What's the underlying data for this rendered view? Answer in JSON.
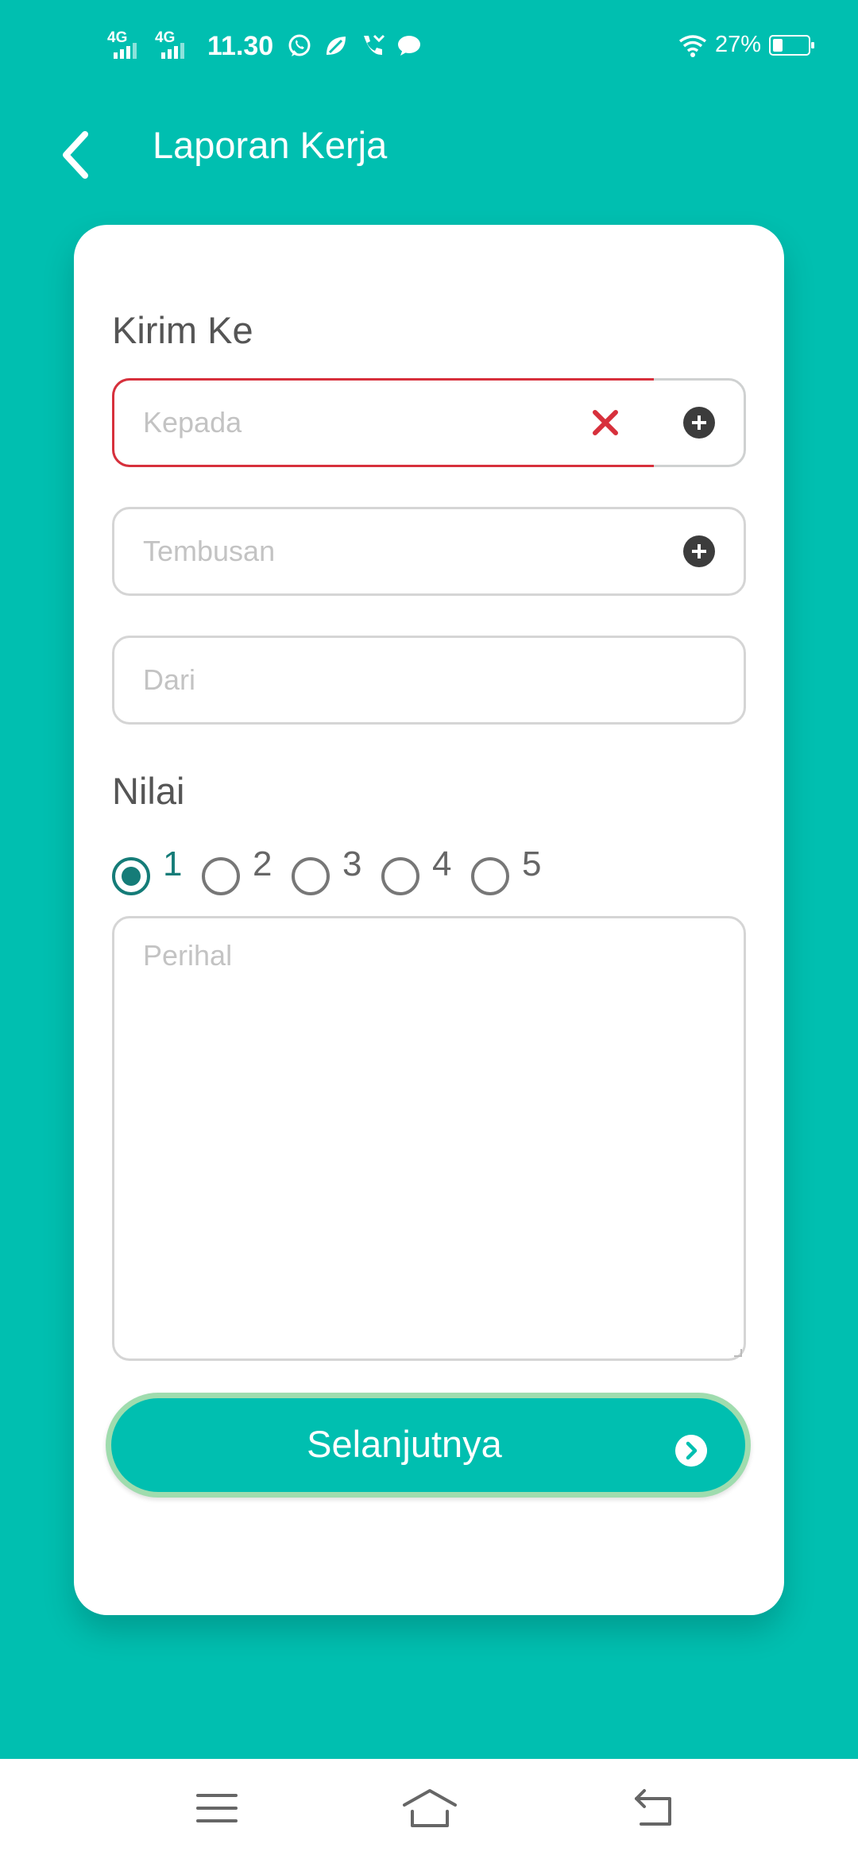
{
  "status_bar": {
    "network1": "4G",
    "network2": "4G",
    "time": "11.30",
    "battery_percent": "27%",
    "battery_level": 0.27,
    "icons": [
      "whatsapp-icon",
      "leaf-icon",
      "missed-call-icon",
      "message-icon",
      "wifi-icon",
      "battery-icon"
    ]
  },
  "app_bar": {
    "title": "Laporan Kerja",
    "back_icon": "back-arrow-icon"
  },
  "form": {
    "send_to_label": "Kirim Ke",
    "to_placeholder": "Kepada",
    "cc_placeholder": "Tembusan",
    "from_placeholder": "Dari",
    "rating_label": "Nilai",
    "rating_options": [
      "1",
      "2",
      "3",
      "4",
      "5"
    ],
    "rating_selected": "1",
    "subject_placeholder": "Perihal",
    "next_label": "Selanjutnya"
  },
  "colors": {
    "primary": "#00BFB0",
    "error": "#D7303C",
    "radio_checked": "#157C78",
    "button_border": "#9FDCAE"
  },
  "nav_bar": {
    "icons": [
      "menu-icon",
      "home-icon",
      "back-icon"
    ]
  }
}
